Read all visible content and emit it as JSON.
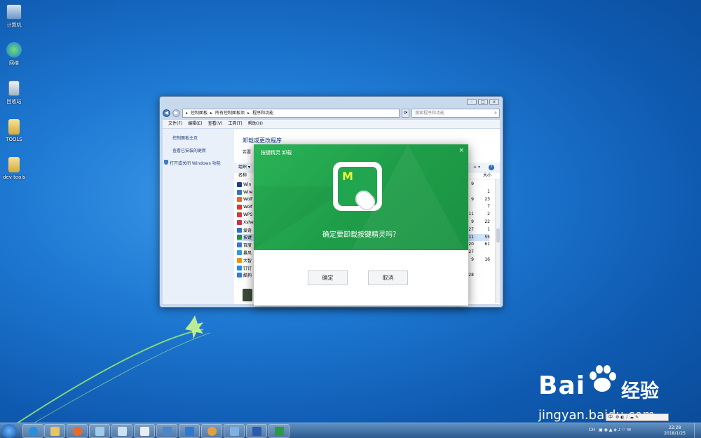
{
  "desktop": {
    "icons": [
      {
        "label": "计算机",
        "icon": "computer-icon"
      },
      {
        "label": "网络",
        "icon": "network-icon"
      },
      {
        "label": "回收站",
        "icon": "recycle-bin-icon"
      },
      {
        "label": "TOOLS",
        "icon": "folder-icon"
      },
      {
        "label": "dev tools",
        "icon": "folder-icon"
      }
    ]
  },
  "explorer": {
    "address": [
      "控制面板",
      "所有控制面板项",
      "程序和功能"
    ],
    "search_placeholder": "搜索程序和功能",
    "menu": [
      "文件(F)",
      "编辑(E)",
      "查看(V)",
      "工具(T)",
      "帮助(H)"
    ],
    "left_links": [
      "控制面板主页",
      "查看已安装的更新",
      "打开或关闭 Windows 功能"
    ],
    "title": "卸载或更改程序",
    "subtitle": "若要",
    "toolbar_organize": "组织 ▾",
    "col_name": "名称",
    "col_size": "大小",
    "programs": [
      {
        "name": "Win",
        "color": "#1b3f8f"
      },
      {
        "name": "Wire",
        "color": "#3a6fc8"
      },
      {
        "name": "Wolf",
        "color": "#e8682a"
      },
      {
        "name": "Wolf",
        "color": "#d83a2a"
      },
      {
        "name": "WPS",
        "color": "#d23b3b"
      },
      {
        "name": "Xshe",
        "color": "#c8324a"
      },
      {
        "name": "爱奇",
        "color": "#2f6fcf"
      },
      {
        "name": "按键",
        "color": "#2a8a3f"
      },
      {
        "name": "百度",
        "color": "#3478d4"
      },
      {
        "name": "暴风",
        "color": "#3796e0"
      },
      {
        "name": "大智",
        "color": "#e09520"
      },
      {
        "name": "钉钉",
        "color": "#1f8fe8"
      },
      {
        "name": "酷狗",
        "color": "#2a7de0"
      }
    ],
    "mid_values": [
      "9",
      "",
      "9",
      "",
      "11",
      "9",
      "27",
      "11",
      "20",
      "27",
      "9",
      "",
      "28"
    ],
    "sizes": [
      "",
      "1",
      "23",
      "7",
      "2",
      "22",
      "1",
      "55",
      "61",
      "",
      "16",
      "",
      ""
    ]
  },
  "dialog": {
    "title": "按键精灵 卸载",
    "logo_letter": "M",
    "question": "确定要卸载按键精灵吗？",
    "ok_label": "确定",
    "cancel_label": "取消",
    "close_glyph": "×"
  },
  "taskbar": {
    "ime": "CH",
    "time": "22:28",
    "date": "2018/1/25",
    "lang_bar": "中"
  },
  "watermark": {
    "brand": "Bai",
    "brand2": "经验",
    "url": "jingyan.baidu.com"
  }
}
